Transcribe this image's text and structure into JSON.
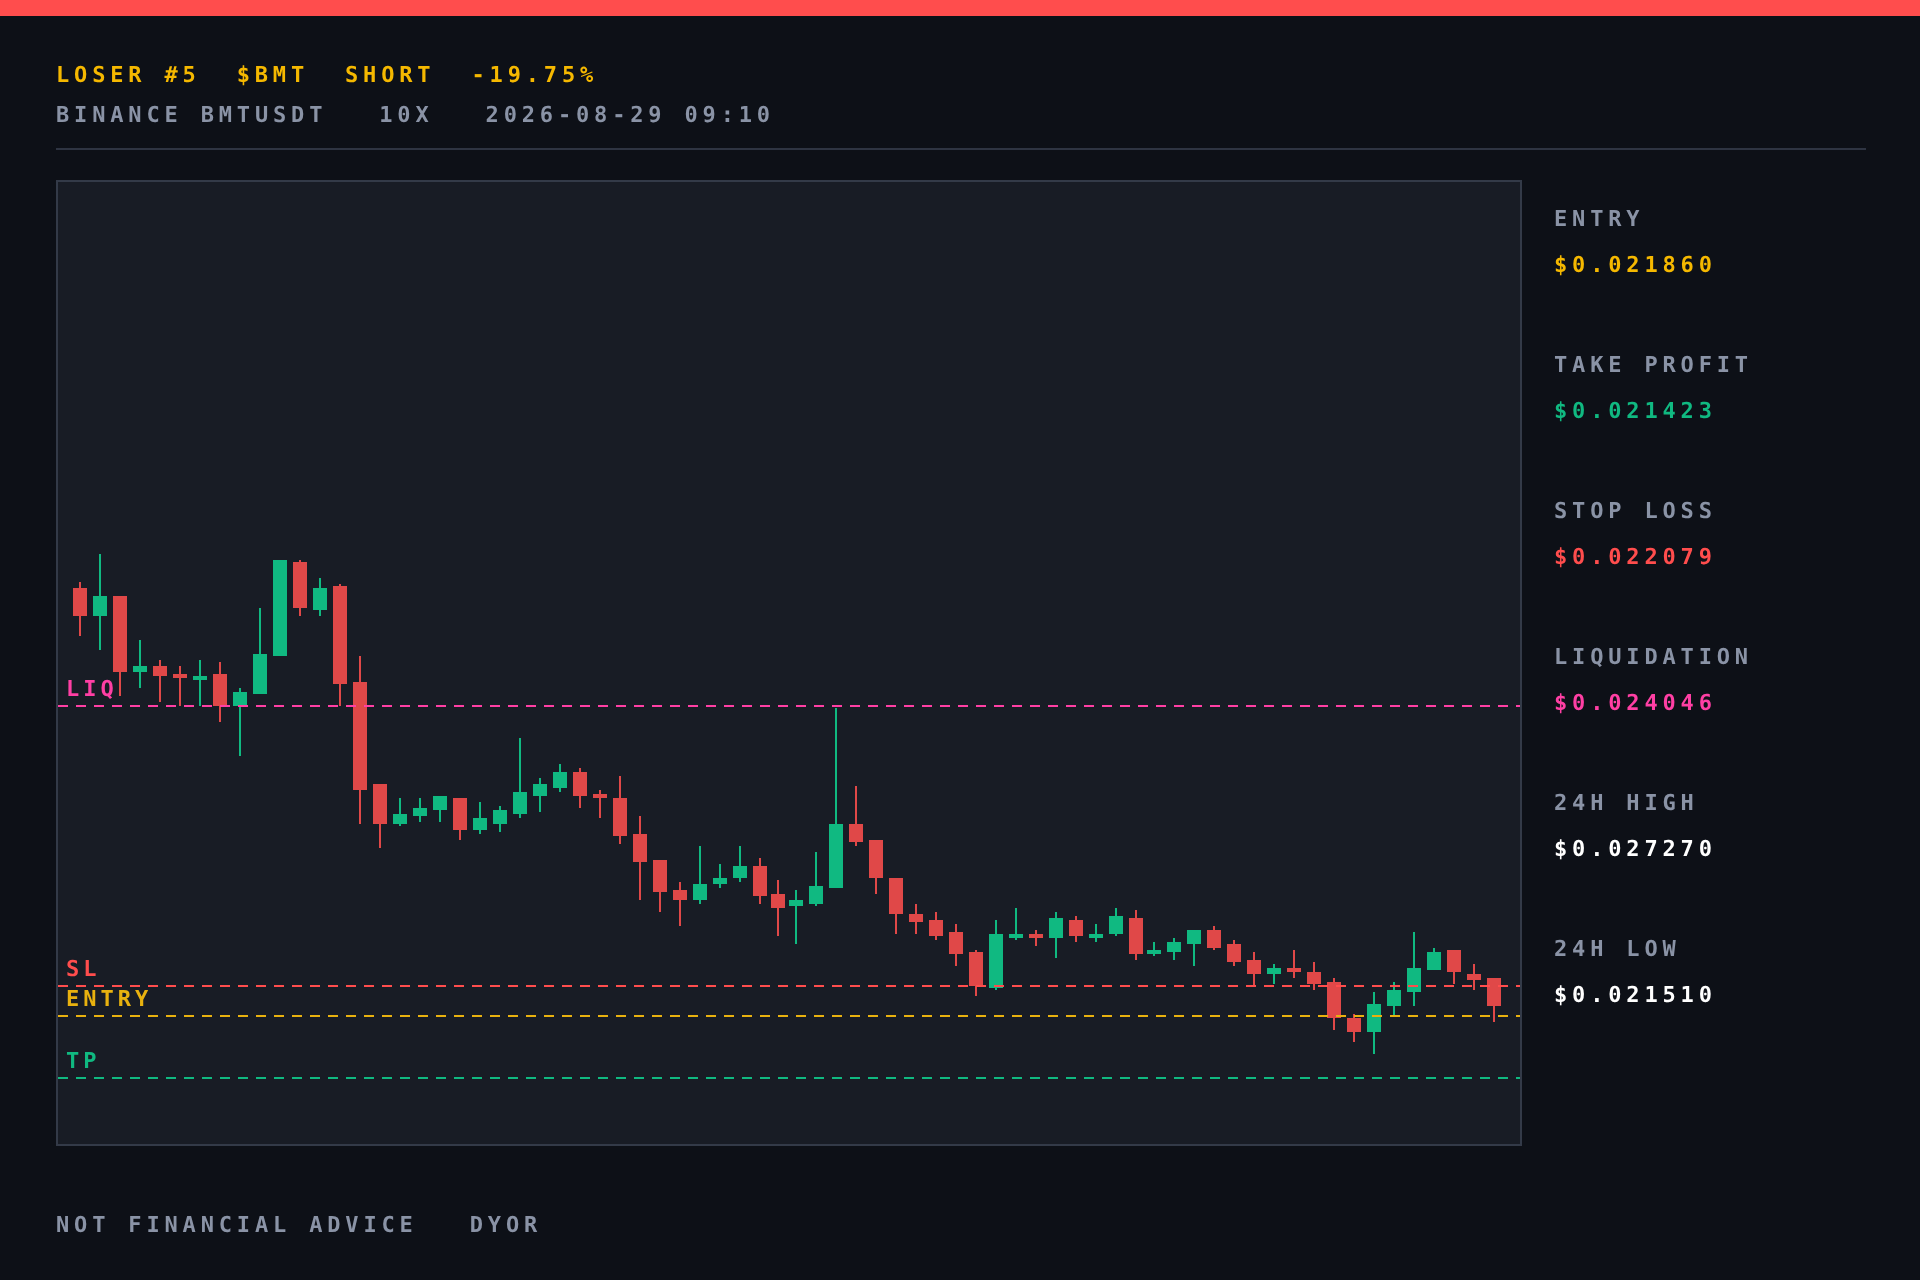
{
  "header": {
    "title_parts": [
      {
        "text": "LOSER #5"
      },
      {
        "text": "$BMT"
      },
      {
        "text": "SHORT"
      },
      {
        "text": "-19.75%"
      }
    ],
    "subtitle_parts": [
      {
        "text": "BINANCE BMTUSDT"
      },
      {
        "text": "10X"
      },
      {
        "text": "2026-08-29 09:10"
      }
    ]
  },
  "chart": {
    "levels": [
      {
        "label": "LIQ",
        "color": "#ff3fa4"
      },
      {
        "label": "SL",
        "color": "#ff4d4d"
      },
      {
        "label": "ENTRY",
        "color": "#e8b10f"
      },
      {
        "label": "TP",
        "color": "#10b981"
      }
    ]
  },
  "stats": [
    {
      "label": "ENTRY",
      "value": "$0.021860",
      "color": "#f5b800"
    },
    {
      "label": "TAKE PROFIT",
      "value": "$0.021423",
      "color": "#10b981"
    },
    {
      "label": "STOP LOSS",
      "value": "$0.022079",
      "color": "#ff4d4d"
    },
    {
      "label": "LIQUIDATION",
      "value": "$0.024046",
      "color": "#ff3fa4"
    },
    {
      "label": "24H HIGH",
      "value": "$0.027270",
      "color": "#ffffff"
    },
    {
      "label": "24H LOW",
      "value": "$0.021510",
      "color": "#ffffff"
    }
  ],
  "footer": {
    "parts": [
      {
        "text": "NOT FINANCIAL ADVICE"
      },
      {
        "text": "DYOR"
      }
    ]
  }
}
